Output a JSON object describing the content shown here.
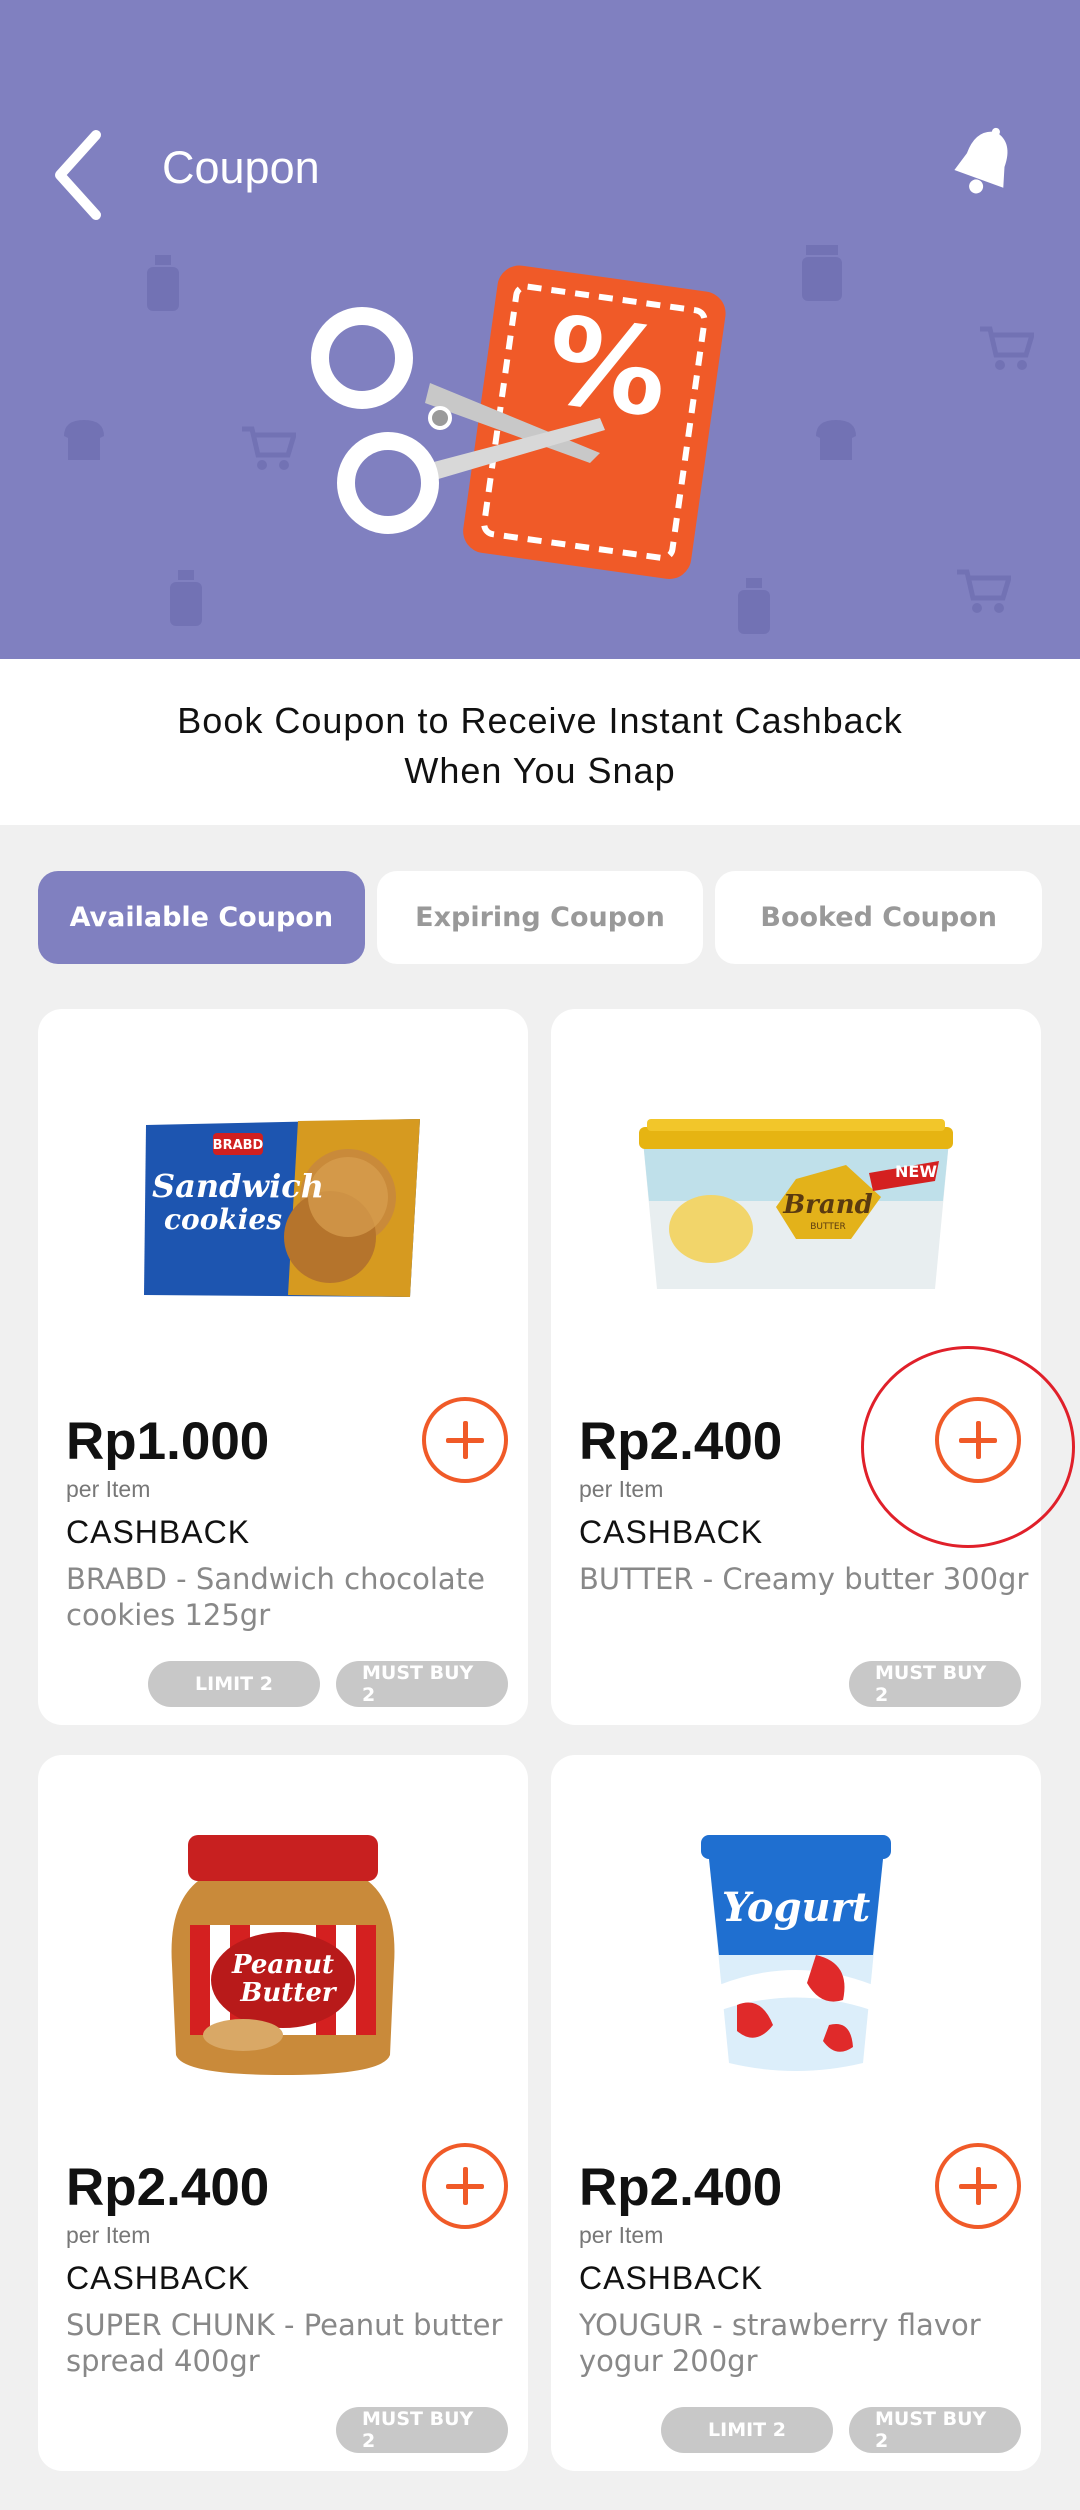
{
  "header": {
    "title": "Coupon",
    "back_icon": "chevron-left-icon",
    "bell_icon": "bell-icon",
    "background_color": "#8080c0",
    "hero_icon": "scissors-coupon-percent-icon"
  },
  "banner": {
    "line1": "Book Coupon to Receive Instant Cashback",
    "line2": "When You Snap"
  },
  "tabs": [
    {
      "label": "Available Coupon",
      "active": true
    },
    {
      "label": "Expiring Coupon",
      "active": false
    },
    {
      "label": "Booked Coupon",
      "active": false
    }
  ],
  "cards": [
    {
      "price": "Rp1.000",
      "per": "per Item",
      "cashback": "CASHBACK",
      "description": "BRABD - Sandwich chocolate cookies 125gr",
      "badges": [
        "LIMIT 2",
        "MUST BUY 2"
      ],
      "image": "sandwich-cookies-pack",
      "image_text": [
        "Sandwich",
        "cookies",
        "BRABD"
      ]
    },
    {
      "price": "Rp2.400",
      "per": "per Item",
      "cashback": "CASHBACK",
      "description": "BUTTER - Creamy butter 300gr",
      "badges": [
        "MUST BUY 2"
      ],
      "image": "butter-tub",
      "image_text": [
        "Brand",
        "BUTTER",
        "NEW"
      ]
    },
    {
      "price": "Rp2.400",
      "per": "per Item",
      "cashback": "CASHBACK",
      "description": "SUPER CHUNK - Peanut butter spread 400gr",
      "badges": [
        "MUST BUY 2"
      ],
      "image": "peanut-butter-jar",
      "image_text": [
        "Peanut",
        "Butter"
      ]
    },
    {
      "price": "Rp2.400",
      "per": "per Item",
      "cashback": "CASHBACK",
      "description": "YOUGUR -  strawberry flavor yogur 200gr",
      "badges": [
        "LIMIT 2",
        "MUST BUY 2"
      ],
      "image": "strawberry-yogurt-cup",
      "image_text": [
        "Yogurt"
      ]
    }
  ],
  "colors": {
    "accent": "#8080c0",
    "add_button": "#f05a28",
    "badge": "#c8c8c8",
    "highlight": "#e0202a"
  }
}
